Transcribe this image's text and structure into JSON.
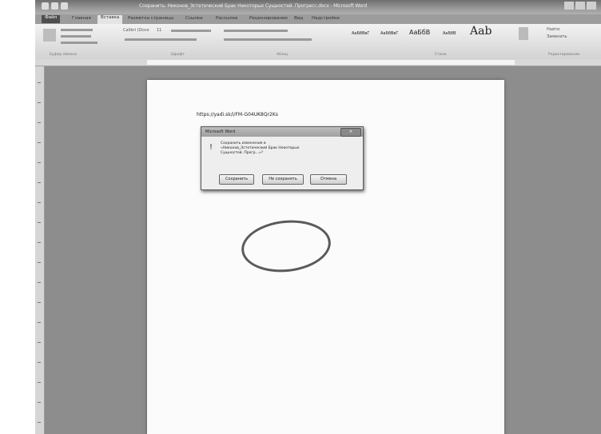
{
  "window": {
    "title": "Сохранить: Никонов_Эстетический Брак Некоторых Сущностей. Прогресс.docx - Microsoft Word",
    "controls": [
      "–",
      "▫",
      "✕"
    ]
  },
  "tabs": {
    "file": "Файл",
    "home": "Главная",
    "insert": "Вставка",
    "layout": "Разметка страницы",
    "references": "Ссылки",
    "mailings": "Рассылки",
    "review": "Рецензирование",
    "view": "Вид",
    "addins": "Надстройки"
  },
  "ribbon": {
    "font_name": "Calibri (Осно",
    "font_size": "11",
    "clipboard_label": "Буфер обмена",
    "font_label": "Шрифт",
    "paragraph_label": "Абзац",
    "styles_label": "Стили",
    "editing_label": "Редактирование",
    "styles": [
      "АаБбВвГ",
      "АаБбВвГ",
      "АаБбВ",
      "АаБбВ",
      "Aab"
    ],
    "find": "Найти",
    "replace": "Заменить"
  },
  "document": {
    "url_text": "https://yadi.sk/i/FM-G04UK8Qr2Ks"
  },
  "dialog": {
    "title": "Microsoft Word",
    "message_lines": [
      "Сохранить изменения в",
      "«Никонов_Эстетический Брак Некоторых",
      "Сущностей. Прогр...»?"
    ],
    "save_label": "Сохранить",
    "dont_save_label": "Не сохранять",
    "cancel_label": "Отмена",
    "close_label": "✕"
  },
  "colors": {
    "highlight_circle": "#5a5a5a"
  }
}
